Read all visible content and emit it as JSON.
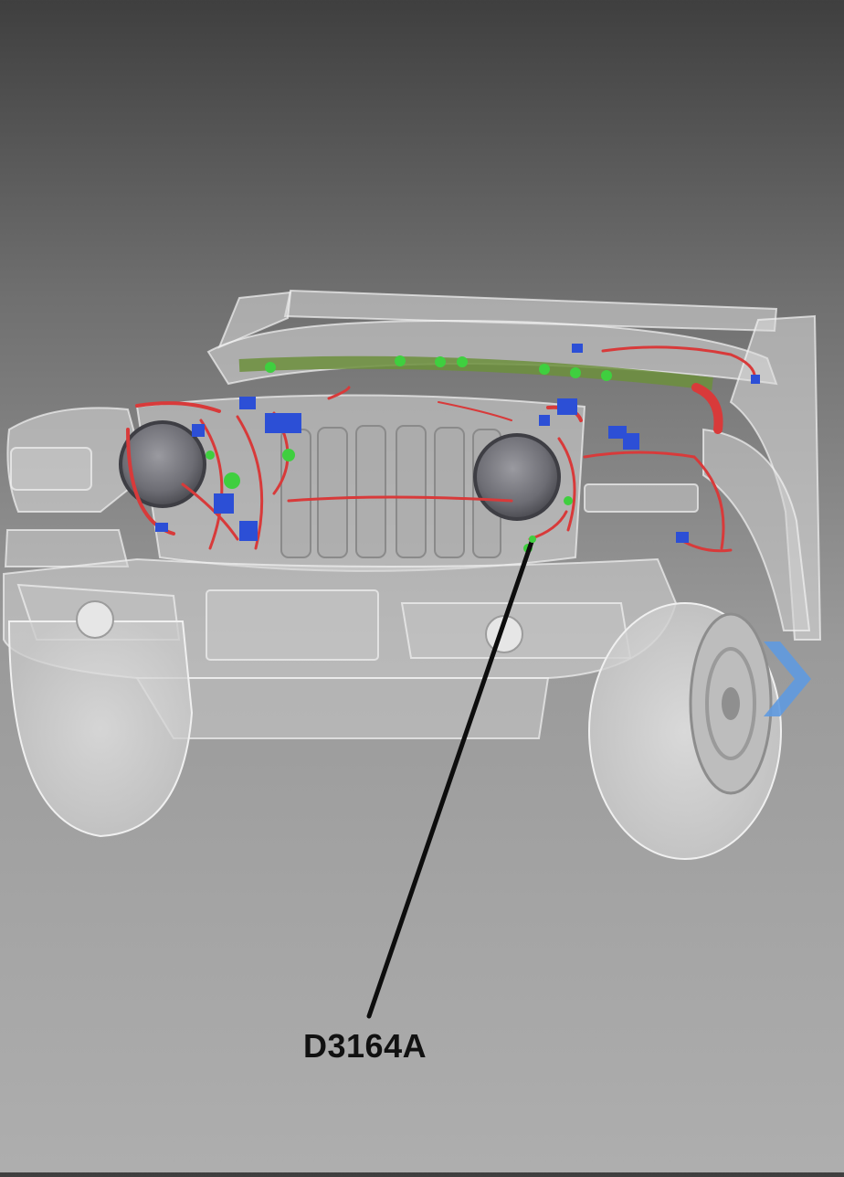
{
  "callout": {
    "label": "D3164A"
  },
  "colors": {
    "harness_red": "#d83a3a",
    "connector_blue": "#2c4fd6",
    "connector_green": "#3fcf3f",
    "body_ghost": "#e4e4e4",
    "nav_arrow": "#5f9ae0"
  },
  "icons": {
    "next": "chevron-right-icon"
  }
}
